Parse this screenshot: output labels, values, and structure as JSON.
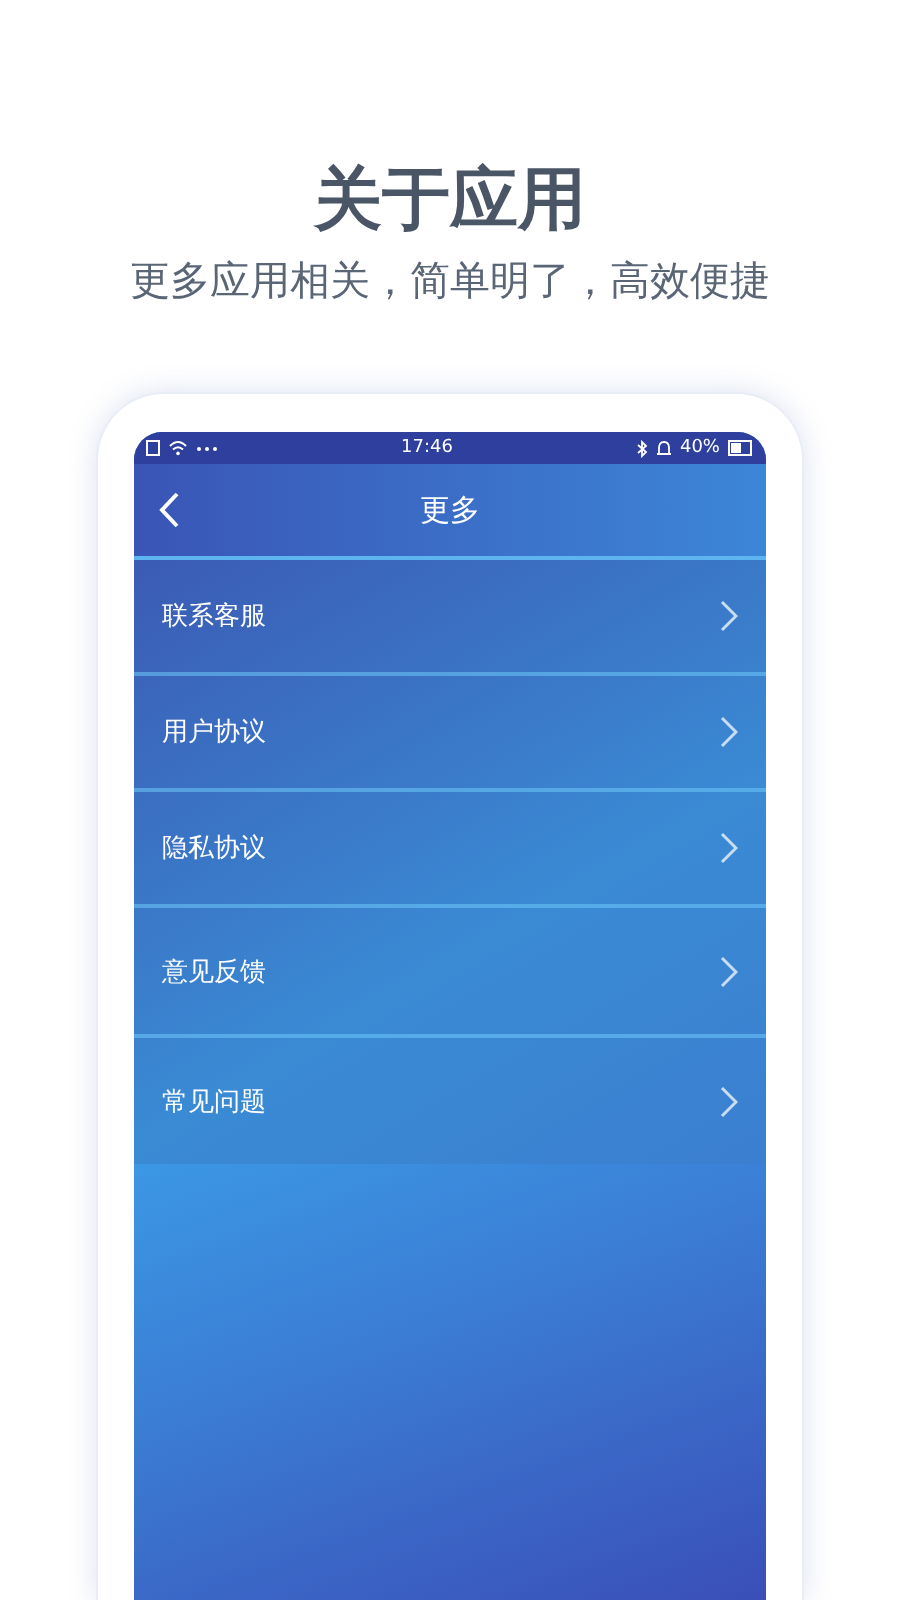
{
  "header": {
    "title": "关于应用",
    "subtitle": "更多应用相关，简单明了，高效便捷"
  },
  "status_bar": {
    "time": "17:46",
    "battery": "40%"
  },
  "nav_bar": {
    "title": "更多"
  },
  "menu": [
    {
      "label": "联系客服"
    },
    {
      "label": "用户协议"
    },
    {
      "label": "隐私协议"
    },
    {
      "label": "意见反馈"
    },
    {
      "label": "常见问题"
    }
  ]
}
